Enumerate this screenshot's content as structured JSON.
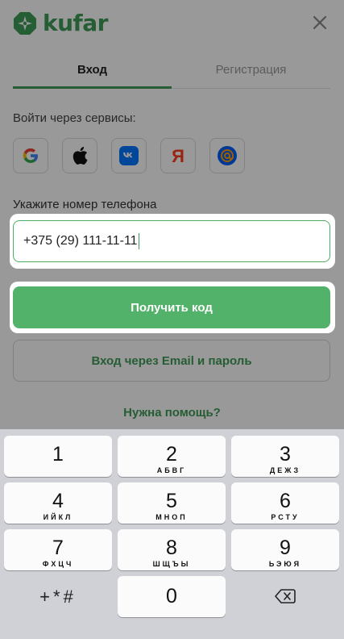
{
  "header": {
    "logo_text": "kufar",
    "logo_icon": "kufar-logo-icon",
    "close_icon": "close-icon"
  },
  "tabs": [
    {
      "label": "Вход",
      "active": true
    },
    {
      "label": "Регистрация",
      "active": false
    }
  ],
  "services": {
    "label": "Войти через сервисы:",
    "items": [
      {
        "name": "google-icon",
        "glyph": "G"
      },
      {
        "name": "apple-icon",
        "glyph": ""
      },
      {
        "name": "vk-icon",
        "glyph": "VK"
      },
      {
        "name": "yandex-icon",
        "glyph": "Я"
      },
      {
        "name": "mail-ru-icon",
        "glyph": "@"
      }
    ]
  },
  "phone": {
    "label": "Укажите номер телефона",
    "value": "+375 (29) 111-11-11"
  },
  "buttons": {
    "get_code": "Получить код",
    "email_login": "Вход через Email и пароль",
    "help": "Нужна помощь?"
  },
  "keyboard": {
    "keys": [
      {
        "num": "1",
        "sub": ""
      },
      {
        "num": "2",
        "sub": "АБВГ"
      },
      {
        "num": "3",
        "sub": "ДЕЖЗ"
      },
      {
        "num": "4",
        "sub": "ИЙКЛ"
      },
      {
        "num": "5",
        "sub": "МНОП"
      },
      {
        "num": "6",
        "sub": "РСТУ"
      },
      {
        "num": "7",
        "sub": "ФХЦЧ"
      },
      {
        "num": "8",
        "sub": "ШЩЪЫ"
      },
      {
        "num": "9",
        "sub": "ЬЭЮЯ"
      }
    ],
    "symbols": "+*#",
    "zero": "0",
    "delete_icon": "backspace-icon"
  },
  "colors": {
    "brand_green": "#3f9b57",
    "button_green": "#52b26a",
    "overlay": "rgba(0,0,0,0.40)"
  }
}
